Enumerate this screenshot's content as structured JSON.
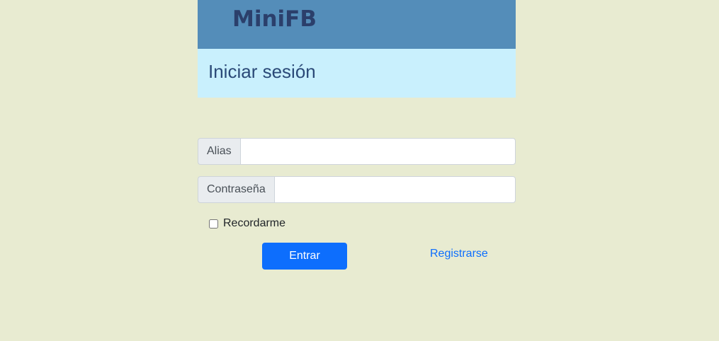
{
  "header": {
    "brand": "MiniFB",
    "title": "Iniciar sesión"
  },
  "form": {
    "alias": {
      "label": "Alias",
      "value": "",
      "placeholder": ""
    },
    "password": {
      "label": "Contraseña",
      "value": "",
      "placeholder": ""
    },
    "remember": {
      "label": "Recordarme",
      "checked": false
    },
    "submit_label": "Entrar",
    "register_label": "Registrarse"
  },
  "colors": {
    "page_background": "#e8ebd1",
    "brand_bar": "#548db9",
    "title_bar": "#c9f0fd",
    "primary": "#0d6efd"
  }
}
